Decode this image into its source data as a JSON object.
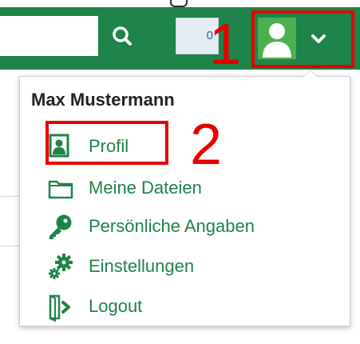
{
  "header": {
    "search": {
      "placeholder": "",
      "value": ""
    },
    "notification_count": "0",
    "user_menu": {
      "chevron": "chevron-down-icon"
    }
  },
  "annotations": {
    "step1": "1",
    "step2": "2"
  },
  "dropdown": {
    "user_name": "Max Mustermann",
    "items": [
      {
        "label": "Profil",
        "icon": "user-card-icon"
      },
      {
        "label": "Meine Dateien",
        "icon": "folder-icon"
      },
      {
        "label": "Persönliche Angaben",
        "icon": "key-icon"
      },
      {
        "label": "Einstellungen",
        "icon": "gears-icon"
      },
      {
        "label": "Logout",
        "icon": "logout-icon"
      }
    ]
  },
  "colors": {
    "header_green": "#1e8449",
    "link_green": "#1e8449",
    "annotation_red": "#e60000",
    "counter_bg": "#e6edf2",
    "counter_text": "#2c5f8f"
  }
}
